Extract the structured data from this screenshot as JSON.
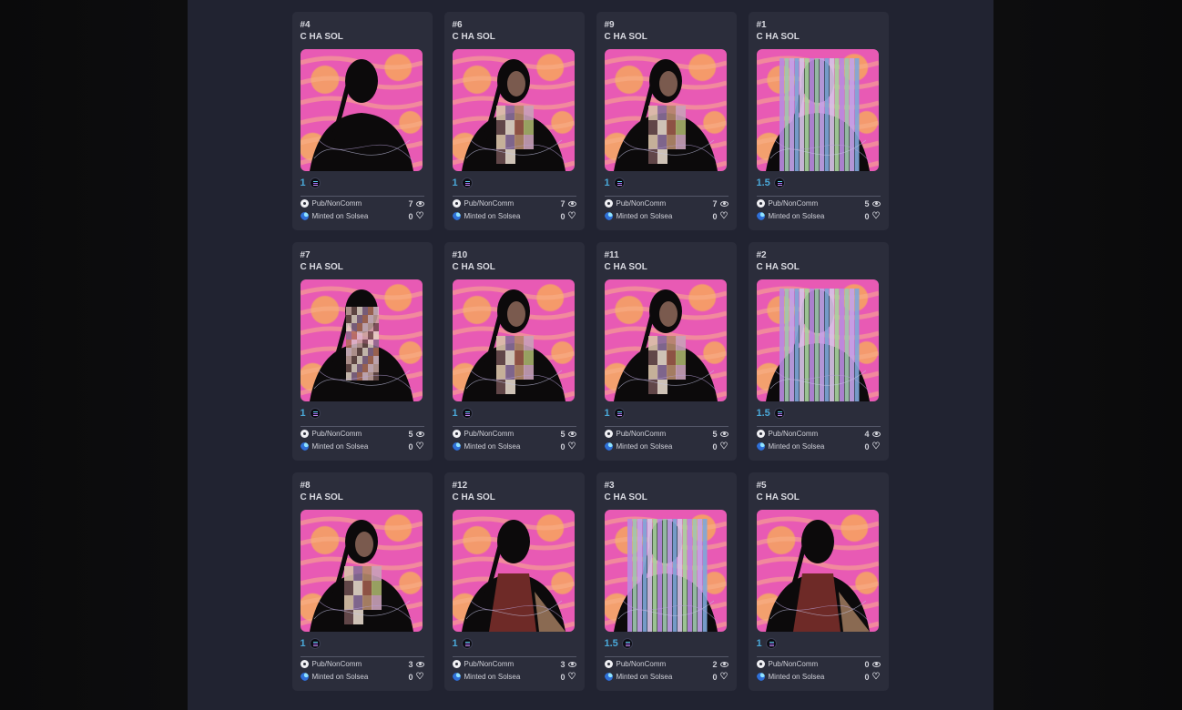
{
  "cards": [
    {
      "id": "#4",
      "name": "C HA SOL",
      "price": "1",
      "license": "Pub/NonComm",
      "minted": "Minted on Solsea",
      "views": "7",
      "likes": "0",
      "variant": "silhouette"
    },
    {
      "id": "#6",
      "name": "C HA SOL",
      "price": "1",
      "license": "Pub/NonComm",
      "minted": "Minted on Solsea",
      "views": "7",
      "likes": "0",
      "variant": "patchwork"
    },
    {
      "id": "#9",
      "name": "C HA SOL",
      "price": "1",
      "license": "Pub/NonComm",
      "minted": "Minted on Solsea",
      "views": "7",
      "likes": "0",
      "variant": "patchwork"
    },
    {
      "id": "#1",
      "name": "C HA SOL",
      "price": "1.5",
      "license": "Pub/NonComm",
      "minted": "Minted on Solsea",
      "views": "5",
      "likes": "0",
      "variant": "stripes"
    },
    {
      "id": "#7",
      "name": "C HA SOL",
      "price": "1",
      "license": "Pub/NonComm",
      "minted": "Minted on Solsea",
      "views": "5",
      "likes": "0",
      "variant": "pixel"
    },
    {
      "id": "#10",
      "name": "C HA SOL",
      "price": "1",
      "license": "Pub/NonComm",
      "minted": "Minted on Solsea",
      "views": "5",
      "likes": "0",
      "variant": "patchwork"
    },
    {
      "id": "#11",
      "name": "C HA SOL",
      "price": "1",
      "license": "Pub/NonComm",
      "minted": "Minted on Solsea",
      "views": "5",
      "likes": "0",
      "variant": "patchwork"
    },
    {
      "id": "#2",
      "name": "C HA SOL",
      "price": "1.5",
      "license": "Pub/NonComm",
      "minted": "Minted on Solsea",
      "views": "4",
      "likes": "0",
      "variant": "stripes"
    },
    {
      "id": "#8",
      "name": "C HA SOL",
      "price": "1",
      "license": "Pub/NonComm",
      "minted": "Minted on Solsea",
      "views": "3",
      "likes": "0",
      "variant": "patchwork"
    },
    {
      "id": "#12",
      "name": "C HA SOL",
      "price": "1",
      "license": "Pub/NonComm",
      "minted": "Minted on Solsea",
      "views": "3",
      "likes": "0",
      "variant": "back"
    },
    {
      "id": "#3",
      "name": "C HA SOL",
      "price": "1.5",
      "license": "Pub/NonComm",
      "minted": "Minted on Solsea",
      "views": "2",
      "likes": "0",
      "variant": "stripes"
    },
    {
      "id": "#5",
      "name": "C HA SOL",
      "price": "1",
      "license": "Pub/NonComm",
      "minted": "Minted on Solsea",
      "views": "0",
      "likes": "0",
      "variant": "back"
    }
  ],
  "icons": {
    "currency": "solana-icon",
    "license": "gear-icon",
    "marketplace": "solsea-icon",
    "views": "eye-icon",
    "likes": "heart-icon"
  },
  "colors": {
    "panel_bg": "#212331",
    "card_bg": "#2b2d3b",
    "price": "#4aa8d8",
    "art_pink": "#e85ab4",
    "art_orange": "#f39a6c"
  }
}
